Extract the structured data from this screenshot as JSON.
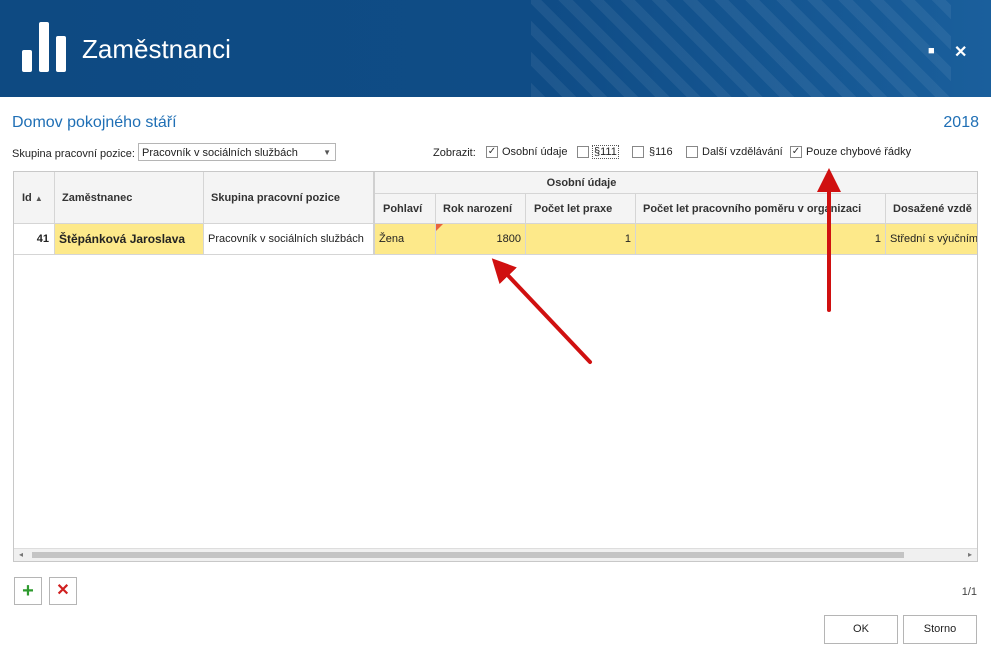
{
  "window": {
    "title": "Zaměstnanci",
    "maximize_icon": "maximize-icon",
    "close_icon": "close-icon",
    "close_glyph": "✕",
    "maximize_glyph": "■"
  },
  "org_name": "Domov pokojného stáří",
  "year": "2018",
  "filter": {
    "group_label": "Skupina pracovní pozice:",
    "group_value": "Pracovník v sociálních službách",
    "show_label": "Zobrazit:"
  },
  "checkboxes": [
    {
      "label": "Osobní údaje",
      "checked": true
    },
    {
      "label": "§111",
      "checked": false
    },
    {
      "label": "§116",
      "checked": false
    },
    {
      "label": "Další vzdělávání",
      "checked": false
    },
    {
      "label": "Pouze chybové řádky",
      "checked": true
    }
  ],
  "table": {
    "group_header": "Osobní údaje",
    "columns": {
      "id": "Id",
      "employee": "Zaměstnanec",
      "group": "Skupina pracovní pozice",
      "gender": "Pohlaví",
      "birth_year": "Rok narození",
      "practice_years": "Počet let praxe",
      "employment_years": "Počet let pracovního poměru v organizaci",
      "education": "Dosažené vzdě"
    },
    "rows": [
      {
        "id": "41",
        "employee": "Štěpánková Jaroslava",
        "group": "Pracovník v sociálních službách",
        "gender": "Žena",
        "birth_year": "1800",
        "practice_years": "1",
        "employment_years": "1",
        "education": "Střední s výučním l"
      }
    ],
    "highlight_color": "#fde98a",
    "sort_icon": "sort-ascending-icon"
  },
  "pager": "1/1",
  "buttons": {
    "add": "+",
    "delete": "✕",
    "ok": "OK",
    "cancel": "Storno"
  },
  "colors": {
    "header_bg": "#0f4c86",
    "accent": "#1f6fb5",
    "arrow": "#d01010"
  }
}
